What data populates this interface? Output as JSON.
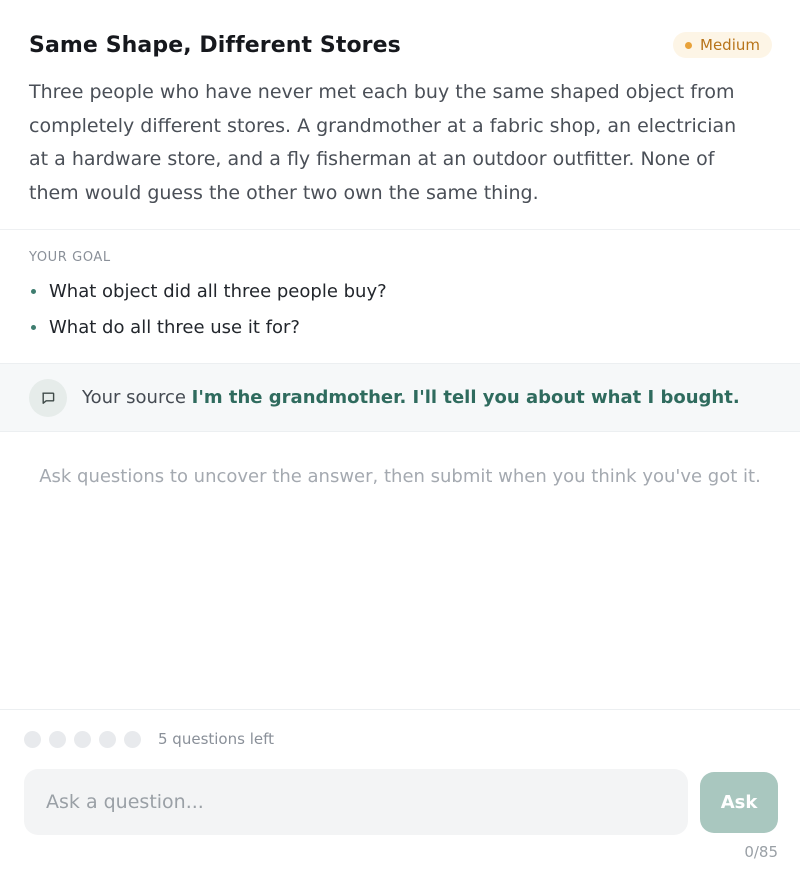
{
  "puzzle": {
    "title": "Same Shape, Different Stores",
    "difficulty": "Medium",
    "description": "Three people who have never met each buy the same shaped object from completely different stores. A grandmother at a fabric shop, an electrician at a hardware store, and a fly fisherman at an outdoor outfitter. None of them would guess the other two own the same thing."
  },
  "goal": {
    "label": "YOUR GOAL",
    "items": [
      "What object did all three people buy?",
      "What do all three use it for?"
    ]
  },
  "source": {
    "icon": "chat-bubble-icon",
    "prefix": "Your source",
    "quote": "I'm the grandmother. I'll tell you about what I bought."
  },
  "hint": "Ask questions to uncover the answer, then submit when you think you've got it.",
  "footer": {
    "questions_left_label": "5 questions left",
    "questions_total": 5,
    "questions_used": 0,
    "input_placeholder": "Ask a question...",
    "input_value": "",
    "ask_label": "Ask",
    "char_count": "0/85"
  },
  "colors": {
    "accent": "#2f6b5e",
    "badge_text": "#b8741a",
    "badge_bg": "#fdf5e6",
    "button_disabled": "#a9c7bf"
  }
}
